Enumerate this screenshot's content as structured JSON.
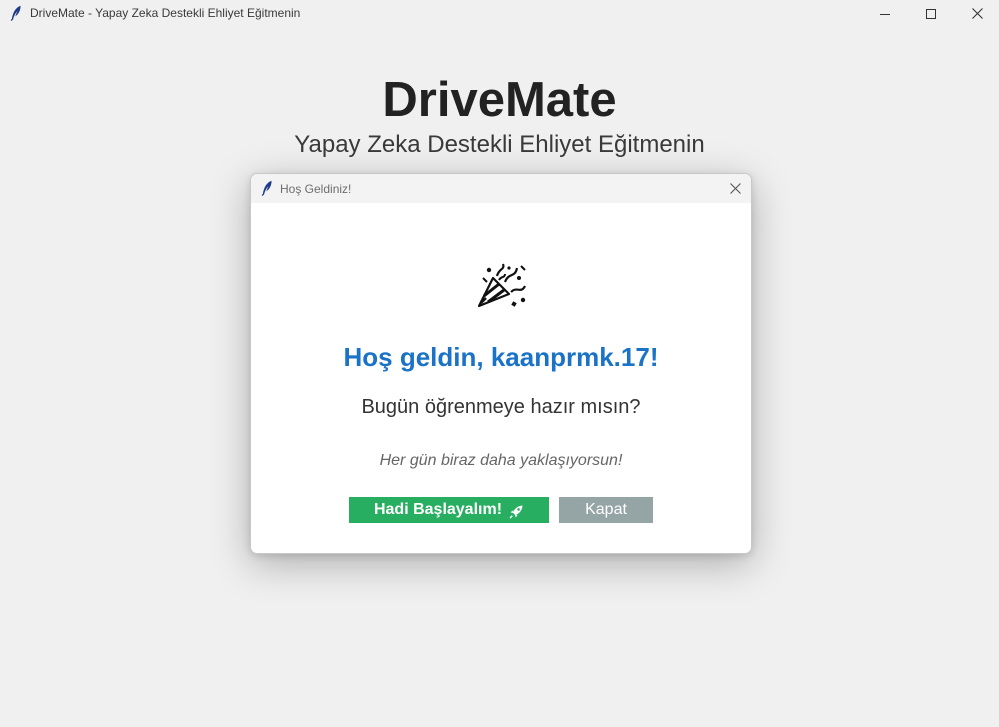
{
  "window": {
    "title": "DriveMate - Yapay Zeka Destekli Ehliyet Eğitmenin",
    "icon": "feather-icon",
    "controls": [
      "minimize-icon",
      "maximize-icon",
      "close-icon"
    ]
  },
  "main": {
    "heading": "DriveMate",
    "subheading": "Yapay Zeka Destekli Ehliyet Eğitmenin"
  },
  "dialog": {
    "title": "Hoş Geldiniz!",
    "icon": "party-popper-icon",
    "welcome": "Hoş geldin, kaanprmk.17!",
    "question": "Bugün öğrenmeye hazır mısın?",
    "motto": "Her gün biraz daha yaklaşıyorsun!",
    "start_button": "Hadi Başlayalım!",
    "start_button_icon": "rocket-icon",
    "close_button": "Kapat"
  },
  "colors": {
    "background": "#f0f0f0",
    "welcome_text": "#1a73c7",
    "start_button": "#27ae60",
    "close_button": "#95a5a6"
  }
}
